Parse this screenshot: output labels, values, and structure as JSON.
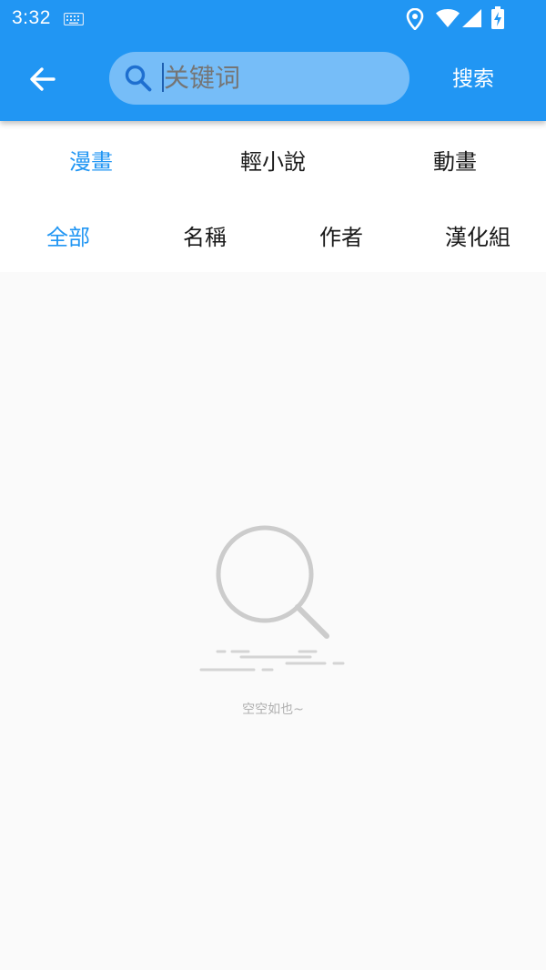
{
  "status_bar": {
    "time": "3:32",
    "icons": [
      "keyboard-icon",
      "location-icon",
      "wifi-icon",
      "signal-icon",
      "battery-charging-icon"
    ]
  },
  "app_bar": {
    "back_icon": "arrow-left-icon",
    "search": {
      "icon": "search-icon",
      "value": "",
      "placeholder": "关键词"
    },
    "search_button_label": "搜索",
    "color": "#2196f3"
  },
  "category_tabs": [
    {
      "label": "漫畫",
      "active": true
    },
    {
      "label": "輕小說",
      "active": false
    },
    {
      "label": "動畫",
      "active": false
    }
  ],
  "filter_tabs": [
    {
      "label": "全部",
      "active": true
    },
    {
      "label": "名稱",
      "active": false
    },
    {
      "label": "作者",
      "active": false
    },
    {
      "label": "漢化組",
      "active": false
    }
  ],
  "empty_state": {
    "icon": "magnifier-illustration-icon",
    "message": "空空如也~"
  },
  "colors": {
    "primary": "#2196f3",
    "search_field": "#76bdf8",
    "active_tab": "#2196f3",
    "empty_text": "#b0b0b0"
  }
}
